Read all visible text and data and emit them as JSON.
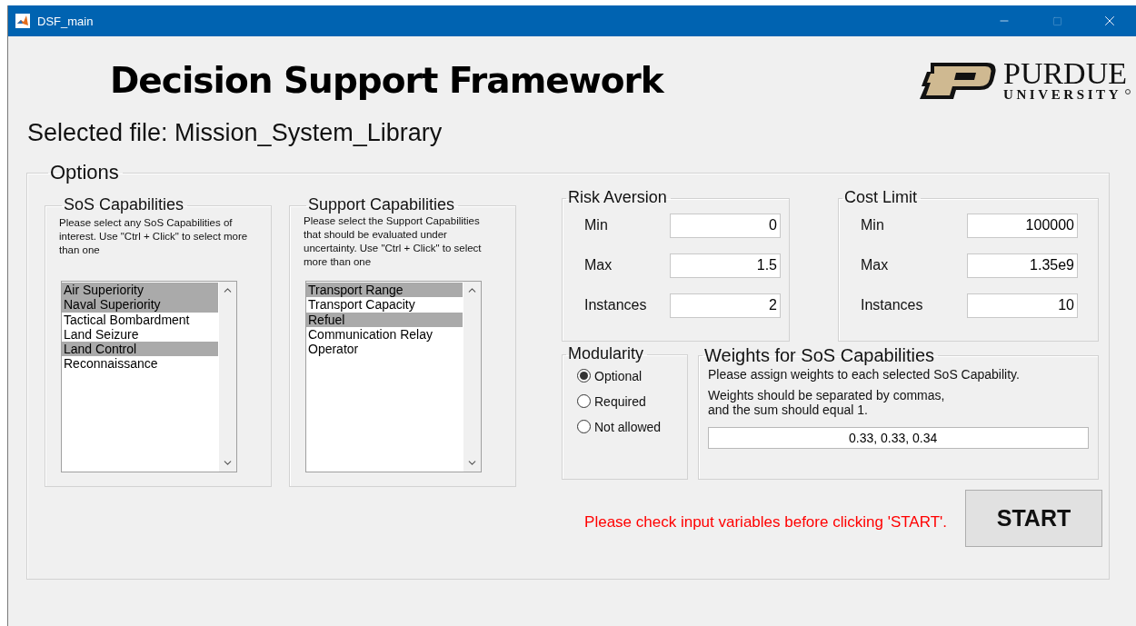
{
  "window": {
    "title": "DSF_main"
  },
  "heading": "Decision Support Framework",
  "logo": {
    "wordmark": "PURDUE",
    "subtitle": "UNIVERSITY"
  },
  "selected_file": "Selected file: Mission_System_Library",
  "options": {
    "title": "Options",
    "sos_capabilities": {
      "title": "SoS Capabilities",
      "instructions": "Please select any SoS Capabilities of interest. Use \"Ctrl + Click\" to select more than one",
      "items": [
        {
          "label": "Air Superiority",
          "selected": true
        },
        {
          "label": "Naval Superiority",
          "selected": true
        },
        {
          "label": "Tactical Bombardment",
          "selected": false
        },
        {
          "label": "Land Seizure",
          "selected": false
        },
        {
          "label": "Land Control",
          "selected": true
        },
        {
          "label": "Reconnaissance",
          "selected": false
        }
      ]
    },
    "support_capabilities": {
      "title": "Support Capabilities",
      "instructions": "Please select the Support Capabilities that should be evaluated under uncertainty. Use \"Ctrl + Click\" to select more than one",
      "items": [
        {
          "label": "Transport Range",
          "selected": true
        },
        {
          "label": "Transport Capacity",
          "selected": false
        },
        {
          "label": "Refuel",
          "selected": true
        },
        {
          "label": "Communication Relay",
          "selected": false
        },
        {
          "label": "Operator",
          "selected": false
        }
      ]
    },
    "risk_aversion": {
      "title": "Risk Aversion",
      "fields": [
        {
          "label": "Min",
          "value": "0"
        },
        {
          "label": "Max",
          "value": "1.5"
        },
        {
          "label": "Instances",
          "value": "2"
        }
      ]
    },
    "cost_limit": {
      "title": "Cost Limit",
      "fields": [
        {
          "label": "Min",
          "value": "100000"
        },
        {
          "label": "Max",
          "value": "1.35e9"
        },
        {
          "label": "Instances",
          "value": "10"
        }
      ]
    },
    "modularity": {
      "title": "Modularity",
      "options": [
        {
          "label": "Optional",
          "selected": true
        },
        {
          "label": "Required",
          "selected": false
        },
        {
          "label": "Not allowed",
          "selected": false
        }
      ]
    },
    "weights": {
      "title": "Weights for SoS Capabilities",
      "instruction": "Please assign weights to each selected SoS Capability.",
      "note": [
        "Weights should be separated by commas,",
        "and the sum should equal 1."
      ],
      "value": "0.33, 0.33, 0.34"
    },
    "warning": "Please check input variables before clicking 'START'.",
    "start_button": "START"
  }
}
